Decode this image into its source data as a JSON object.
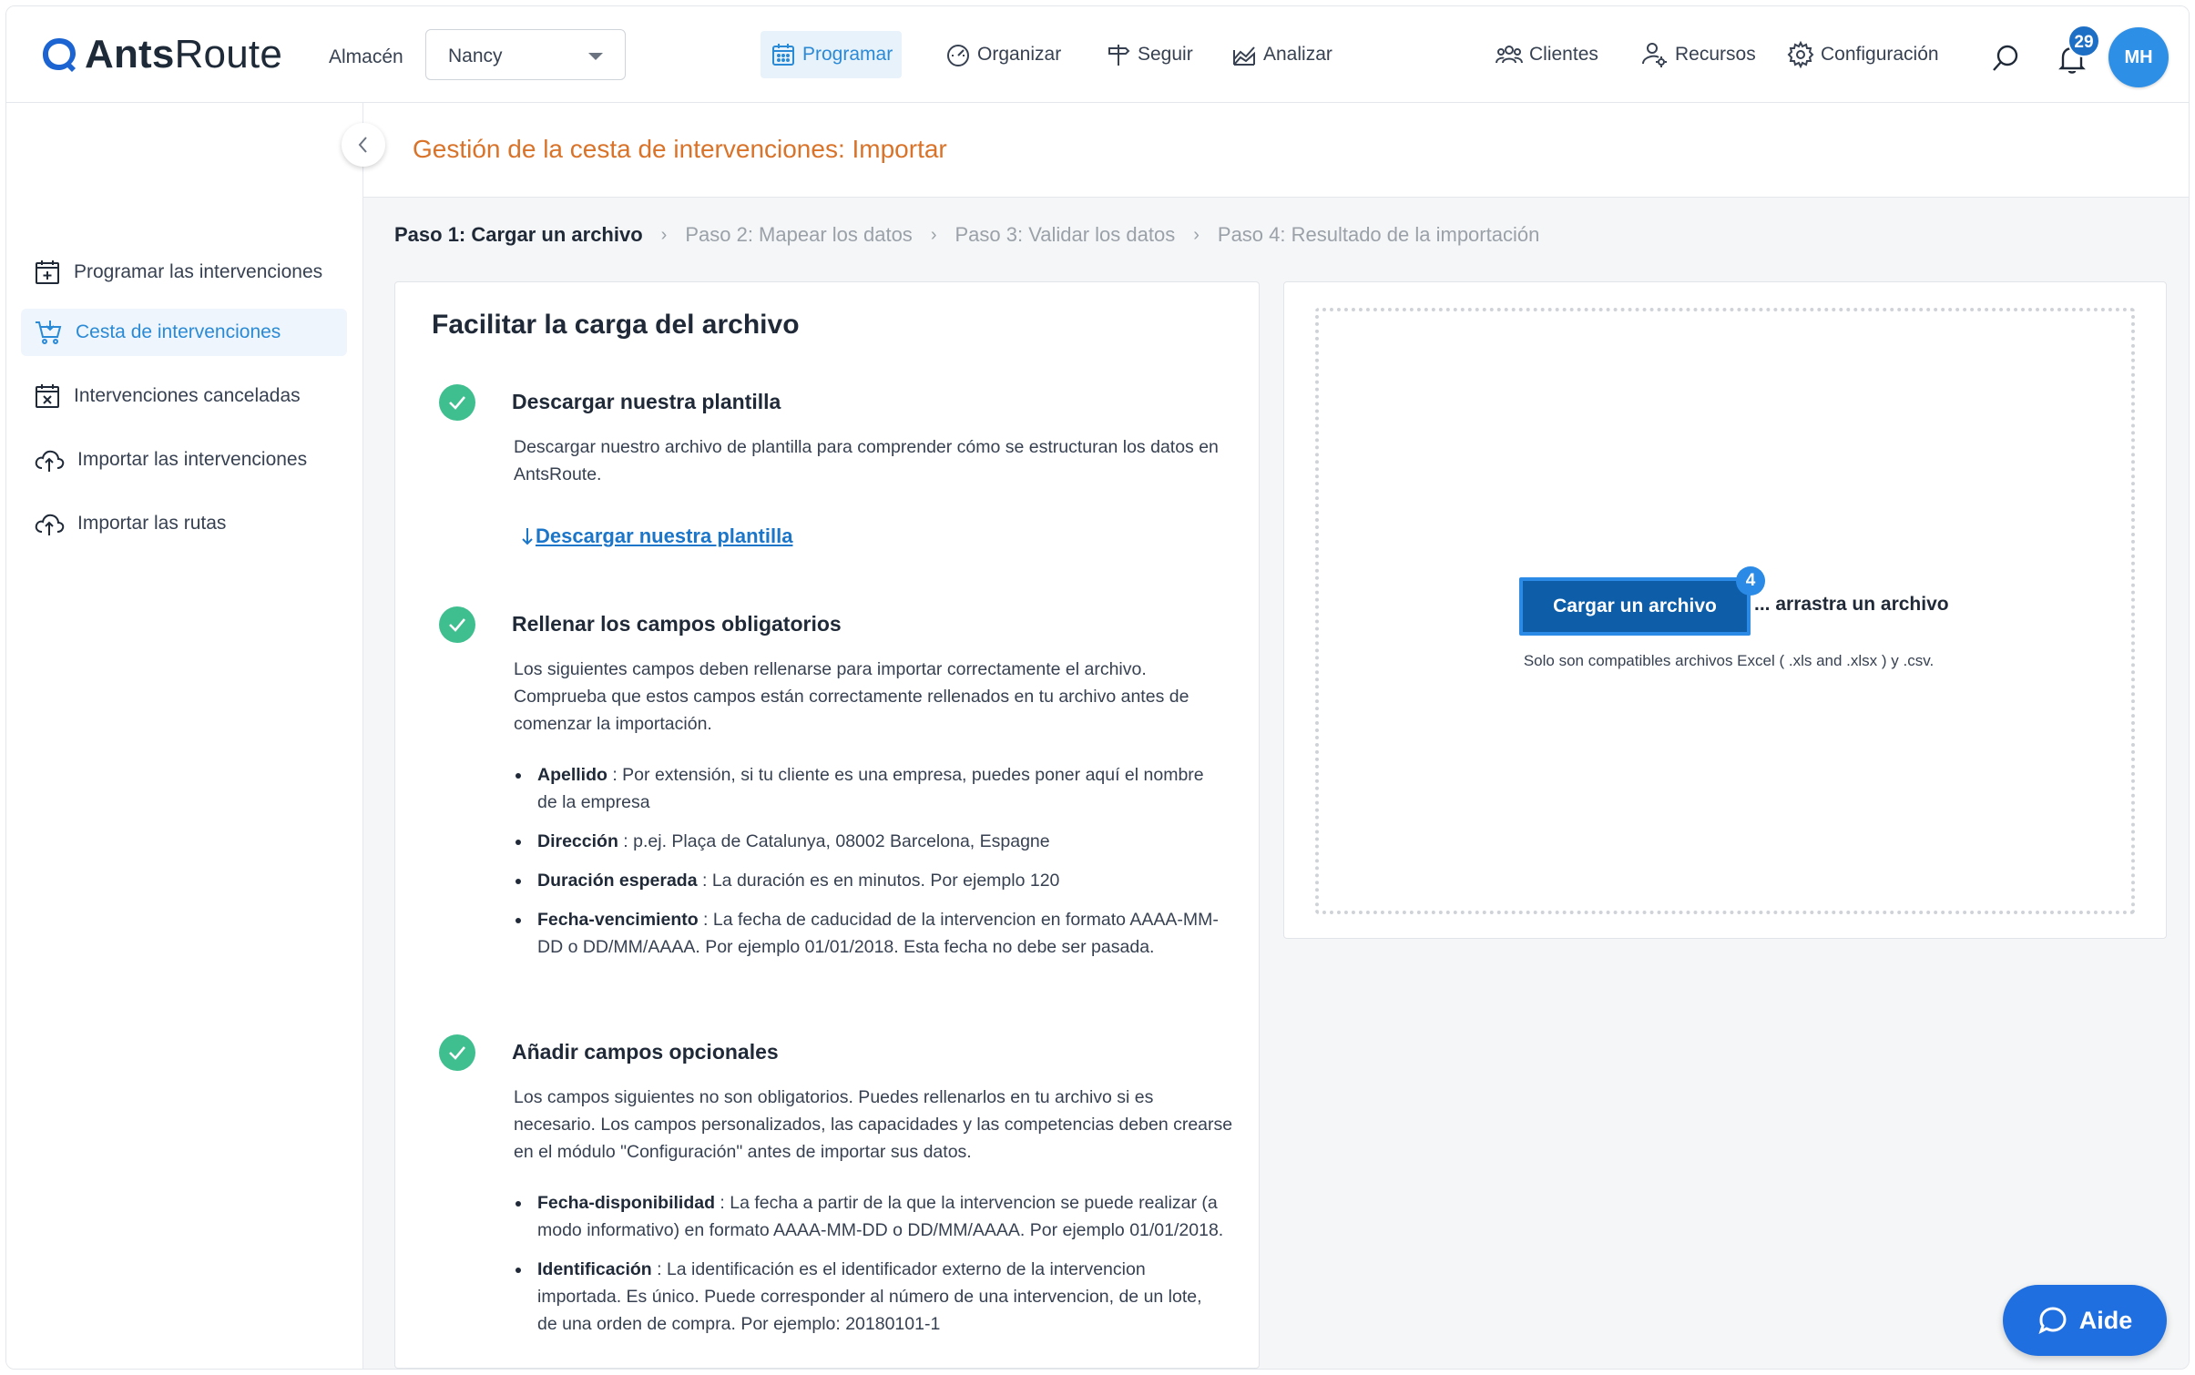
{
  "app": {
    "logo_text_bold": "Ants",
    "logo_text_light": "Route"
  },
  "header": {
    "warehouse_label": "Almacén",
    "warehouse_value": "Nancy",
    "nav": {
      "programar": "Programar",
      "organizar": "Organizar",
      "seguir": "Seguir",
      "analizar": "Analizar",
      "clientes": "Clientes",
      "recursos": "Recursos",
      "configuracion": "Configuración"
    },
    "notifications_count": "29",
    "avatar_initials": "MH"
  },
  "sidebar": {
    "items": [
      {
        "label": "Programar las intervenciones"
      },
      {
        "label": "Cesta de intervenciones"
      },
      {
        "label": "Intervenciones canceladas"
      },
      {
        "label": "Importar las intervenciones"
      },
      {
        "label": "Importar las rutas"
      }
    ]
  },
  "page": {
    "title": "Gestión de la cesta de intervenciones: Importar",
    "steps": [
      {
        "label": "Paso 1: Cargar un archivo"
      },
      {
        "label": "Paso 2: Mapear los datos"
      },
      {
        "label": "Paso 3: Validar los datos"
      },
      {
        "label": "Paso 4: Resultado de la importación"
      }
    ]
  },
  "guide": {
    "title": "Facilitar la carga del archivo",
    "s1": {
      "title": "Descargar nuestra plantilla",
      "text": "Descargar nuestro archivo de plantilla para comprender cómo se estructuran los datos en AntsRoute.",
      "link": "Descargar nuestra plantilla"
    },
    "s2": {
      "title": "Rellenar los campos obligatorios",
      "text": "Los siguientes campos deben rellenarse para importar correctamente el archivo. Comprueba que estos campos están correctamente rellenados en tu archivo antes de comenzar la importación.",
      "fields": [
        {
          "name": "Apellido",
          "desc": " : Por extensión, si tu cliente es una empresa, puedes poner aquí el nombre de la empresa"
        },
        {
          "name": "Dirección",
          "desc": " : p.ej. Plaça de Catalunya, 08002 Barcelona, Espagne"
        },
        {
          "name": "Duración esperada",
          "desc": " : La duración es en minutos. Por ejemplo 120"
        },
        {
          "name": "Fecha-vencimiento",
          "desc": " : La fecha de caducidad de la intervencion en formato AAAA-MM-DD o DD/MM/AAAA. Por ejemplo 01/01/2018. Esta fecha no debe ser pasada."
        }
      ]
    },
    "s3": {
      "title": "Añadir campos opcionales",
      "text": "Los campos siguientes no son obligatorios. Puedes rellenarlos en tu archivo si es necesario. Los campos personalizados, las capacidades y las competencias deben crearse en el módulo \"Configuración\" antes de importar sus datos.",
      "fields": [
        {
          "name": "Fecha-disponibilidad",
          "desc": " : La fecha a partir de la que la intervencion se puede realizar (a modo informativo) en formato AAAA-MM-DD o DD/MM/AAAA. Por ejemplo 01/01/2018."
        },
        {
          "name": "Identificación",
          "desc": " : La identificación es el identificador externo de la intervencion importada. Es único. Puede corresponder al número de una intervencion, de un lote, de una orden de compra. Por ejemplo: 20180101-1"
        }
      ]
    }
  },
  "upload": {
    "button": "Cargar un archivo",
    "badge": "4",
    "drag_text": "... arrastra un archivo",
    "compat": "Solo son compatibles archivos Excel ( .xls and .xlsx ) y .csv."
  },
  "help": {
    "label": "Aide"
  },
  "colors": {
    "accent": "#2b8ad6",
    "title_orange": "#d9732a",
    "check_green": "#3fbf8f",
    "button_blue": "#0d5da8",
    "help_blue": "#1f6fe0"
  }
}
